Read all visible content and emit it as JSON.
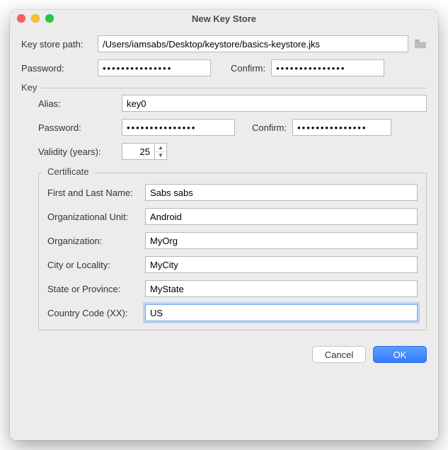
{
  "window": {
    "title": "New Key Store"
  },
  "path": {
    "label": "Key store path:",
    "value": "/Users/iamsabs/Desktop/keystore/basics-keystore.jks"
  },
  "pwd": {
    "label": "Password:",
    "value": "•••••••••••••••",
    "confirm_label": "Confirm:",
    "confirm_value": "•••••••••••••••"
  },
  "key": {
    "group_label": "Key",
    "alias_label": "Alias:",
    "alias_value": "key0",
    "pwd_label": "Password:",
    "pwd_value": "•••••••••••••••",
    "confirm_label": "Confirm:",
    "confirm_value": "•••••••••••••••",
    "validity_label": "Validity (years):",
    "validity_value": "25"
  },
  "cert": {
    "group_label": "Certificate",
    "fields": [
      {
        "label": "First and Last Name:",
        "value": "Sabs sabs"
      },
      {
        "label": "Organizational Unit:",
        "value": "Android"
      },
      {
        "label": "Organization:",
        "value": "MyOrg"
      },
      {
        "label": "City or Locality:",
        "value": "MyCity"
      },
      {
        "label": "State or Province:",
        "value": "MyState"
      },
      {
        "label": "Country Code (XX):",
        "value": "US"
      }
    ]
  },
  "buttons": {
    "cancel": "Cancel",
    "ok": "OK"
  }
}
